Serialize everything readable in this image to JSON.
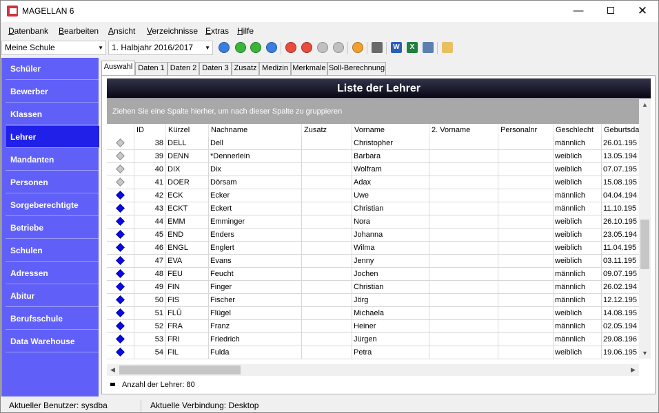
{
  "window": {
    "title": "MAGELLAN 6"
  },
  "menu": [
    "Datenbank",
    "Bearbeiten",
    "Ansicht",
    "Verzeichnisse",
    "Extras",
    "Hilfe"
  ],
  "toolbar": {
    "school": "Meine Schule",
    "term": "1. Halbjahr 2016/2017"
  },
  "sidebar": {
    "items": [
      {
        "label": "Schüler"
      },
      {
        "label": "Bewerber"
      },
      {
        "label": "Klassen"
      },
      {
        "label": "Lehrer"
      },
      {
        "label": "Mandanten"
      },
      {
        "label": "Personen"
      },
      {
        "label": "Sorgeberechtigte"
      },
      {
        "label": "Betriebe"
      },
      {
        "label": "Schulen"
      },
      {
        "label": "Adressen"
      },
      {
        "label": "Abitur"
      },
      {
        "label": "Berufsschule"
      },
      {
        "label": "Data Warehouse"
      }
    ],
    "active": "Lehrer"
  },
  "tabs": [
    "Auswahl",
    "Daten 1",
    "Daten 2",
    "Daten 3",
    "Zusatz",
    "Medizin",
    "Merkmale",
    "Soll-Berechnung"
  ],
  "list": {
    "title": "Liste der Lehrer",
    "group_hint": "Ziehen Sie eine Spalte hierher, um nach dieser Spalte zu gruppieren",
    "columns": [
      "ID",
      "Kürzel",
      "Nachname",
      "Zusatz",
      "Vorname",
      "2. Vorname",
      "Personalnr",
      "Geschlecht",
      "Geburtsda"
    ],
    "rows": [
      {
        "status": "gray",
        "id": "38",
        "kuerzel": "DELL",
        "nachname": "Dell",
        "vorname": "Christopher",
        "geschlecht": "männlich",
        "geburt": "26.01.195"
      },
      {
        "status": "gray",
        "id": "39",
        "kuerzel": "DENN",
        "nachname": "*Dennerlein",
        "vorname": "Barbara",
        "geschlecht": "weiblich",
        "geburt": "13.05.194"
      },
      {
        "status": "gray",
        "id": "40",
        "kuerzel": "DIX",
        "nachname": "Dix",
        "vorname": "Wolfram",
        "geschlecht": "weiblich",
        "geburt": "07.07.195"
      },
      {
        "status": "gray",
        "id": "41",
        "kuerzel": "DOER",
        "nachname": "Dörsam",
        "vorname": "Adax",
        "geschlecht": "weiblich",
        "geburt": "15.08.195"
      },
      {
        "status": "blue",
        "id": "42",
        "kuerzel": "ECK",
        "nachname": "Ecker",
        "vorname": "Uwe",
        "geschlecht": "männlich",
        "geburt": "04.04.194"
      },
      {
        "status": "blue",
        "id": "43",
        "kuerzel": "ECKT",
        "nachname": "Eckert",
        "vorname": "Christian",
        "geschlecht": "männlich",
        "geburt": "11.10.195"
      },
      {
        "status": "blue",
        "id": "44",
        "kuerzel": "EMM",
        "nachname": "Emminger",
        "vorname": "Nora",
        "geschlecht": "weiblich",
        "geburt": "26.10.195"
      },
      {
        "status": "blue",
        "id": "45",
        "kuerzel": "END",
        "nachname": "Enders",
        "vorname": "Johanna",
        "geschlecht": "weiblich",
        "geburt": "23.05.194"
      },
      {
        "status": "blue",
        "id": "46",
        "kuerzel": "ENGL",
        "nachname": "Englert",
        "vorname": "Wilma",
        "geschlecht": "weiblich",
        "geburt": "11.04.195"
      },
      {
        "status": "blue",
        "id": "47",
        "kuerzel": "EVA",
        "nachname": "Evans",
        "vorname": "Jenny",
        "geschlecht": "weiblich",
        "geburt": "03.11.195"
      },
      {
        "status": "blue",
        "id": "48",
        "kuerzel": "FEU",
        "nachname": "Feucht",
        "vorname": "Jochen",
        "geschlecht": "männlich",
        "geburt": "09.07.195"
      },
      {
        "status": "blue",
        "id": "49",
        "kuerzel": "FIN",
        "nachname": "Finger",
        "vorname": "Christian",
        "geschlecht": "männlich",
        "geburt": "26.02.194"
      },
      {
        "status": "blue",
        "id": "50",
        "kuerzel": "FIS",
        "nachname": "Fischer",
        "vorname": "Jörg",
        "geschlecht": "männlich",
        "geburt": "12.12.195"
      },
      {
        "status": "blue",
        "id": "51",
        "kuerzel": "FLÜ",
        "nachname": "Flügel",
        "vorname": "Michaela",
        "geschlecht": "weiblich",
        "geburt": "14.08.195"
      },
      {
        "status": "blue",
        "id": "52",
        "kuerzel": "FRA",
        "nachname": "Franz",
        "vorname": "Heiner",
        "geschlecht": "männlich",
        "geburt": "02.05.194"
      },
      {
        "status": "blue",
        "id": "53",
        "kuerzel": "FRI",
        "nachname": "Friedrich",
        "vorname": "Jürgen",
        "geschlecht": "männlich",
        "geburt": "29.08.196"
      },
      {
        "status": "blue",
        "id": "54",
        "kuerzel": "FIL",
        "nachname": "Fulda",
        "vorname": "Petra",
        "geschlecht": "weiblich",
        "geburt": "19.06.195"
      }
    ],
    "count_label": "Anzahl der Lehrer: 80"
  },
  "status": {
    "user": "Aktueller Benutzer: sysdba",
    "connection": "Aktuelle Verbindung: Desktop"
  }
}
